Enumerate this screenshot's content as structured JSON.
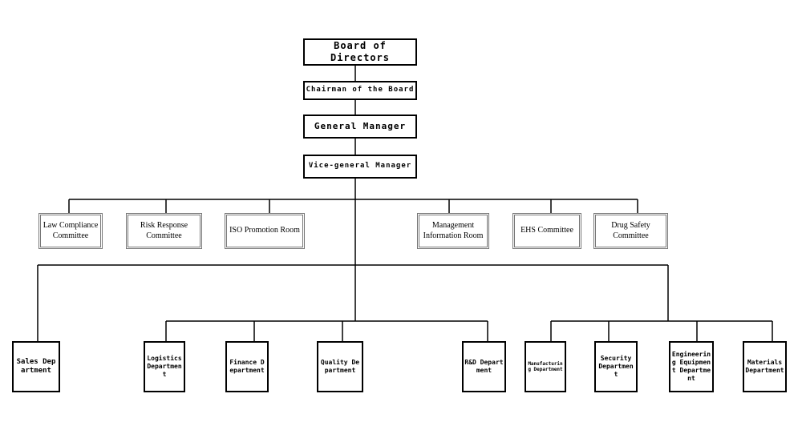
{
  "executives": {
    "board": "Board of Directors",
    "chairman": "Chairman of the Board",
    "general_manager": "General Manager",
    "vice_general_manager": "Vice-general Manager"
  },
  "committees": [
    "Law Compliance Committee",
    "Risk Response Committee",
    "ISO Promotion Room",
    "Management Information Room",
    "EHS Committee",
    "Drug Safety Committee"
  ],
  "departments": [
    "Sales Department",
    "Logistics Department",
    "Finance Department",
    "Quality Department",
    "R&D Department",
    "Manufacturing Department",
    "Security Department",
    "Engineering Equipment Department",
    "Materials Department"
  ]
}
